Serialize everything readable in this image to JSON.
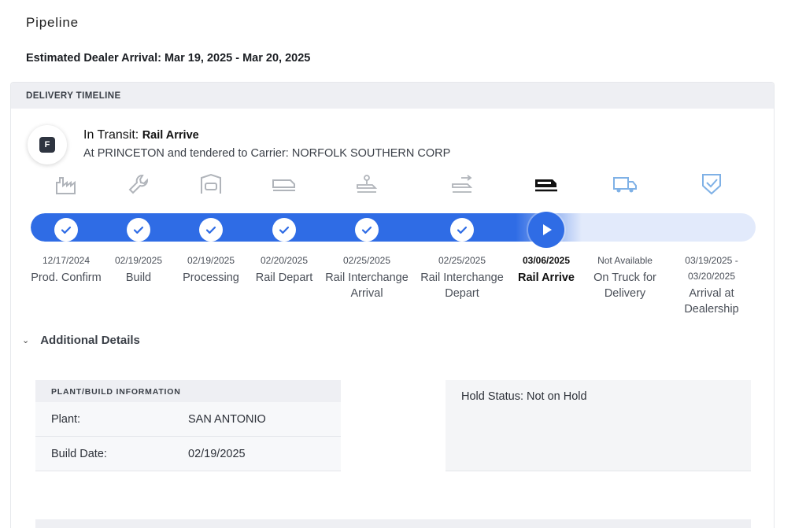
{
  "page": {
    "title": "Pipeline",
    "arrival": "Estimated Dealer Arrival: Mar 19, 2025 - Mar 20, 2025"
  },
  "timeline": {
    "header": "DELIVERY TIMELINE",
    "badge_letter": "F",
    "status_label": "In Transit:",
    "status_value": "Rail Arrive",
    "status_detail": "At PRINCETON and tendered to Carrier: NORFOLK SOUTHERN CORP",
    "progress_fraction": 0.76,
    "steps": [
      {
        "date": "12/17/2024",
        "label": "Prod. Confirm",
        "state": "done",
        "icon": "factory-icon"
      },
      {
        "date": "02/19/2025",
        "label": "Build",
        "state": "done",
        "icon": "wrench-icon"
      },
      {
        "date": "02/19/2025",
        "label": "Processing",
        "state": "done",
        "icon": "car-processing-icon"
      },
      {
        "date": "02/20/2025",
        "label": "Rail Depart",
        "state": "done",
        "icon": "railcar-icon"
      },
      {
        "date": "02/25/2025",
        "label": "Rail Interchange Arrival",
        "state": "done",
        "icon": "railcar-pin-icon"
      },
      {
        "date": "02/25/2025",
        "label": "Rail Interchange Depart",
        "state": "done",
        "icon": "railcar-arrow-icon"
      },
      {
        "date": "03/06/2025",
        "label": "Rail Arrive",
        "state": "current",
        "icon": "railcar-icon"
      },
      {
        "date": "Not Available",
        "label": "On Truck for Delivery",
        "state": "pending",
        "icon": "truck-icon"
      },
      {
        "date": "03/19/2025 - 03/20/2025",
        "label": "Arrival at Dealership",
        "state": "pending",
        "icon": "shield-check-icon"
      }
    ]
  },
  "details": {
    "toggle_label": "Additional Details",
    "plant": {
      "header": "PLANT/BUILD INFORMATION",
      "plant_key": "Plant:",
      "plant_value": "SAN ANTONIO",
      "build_key": "Build Date:",
      "build_value": "02/19/2025"
    },
    "hold_status": "Hold Status: Not on Hold"
  },
  "colors": {
    "accent": "#2f6ce5",
    "track_bg": "#e2eafb",
    "icon_done": "#b0b4ba",
    "icon_pending": "#7fb1e6"
  }
}
